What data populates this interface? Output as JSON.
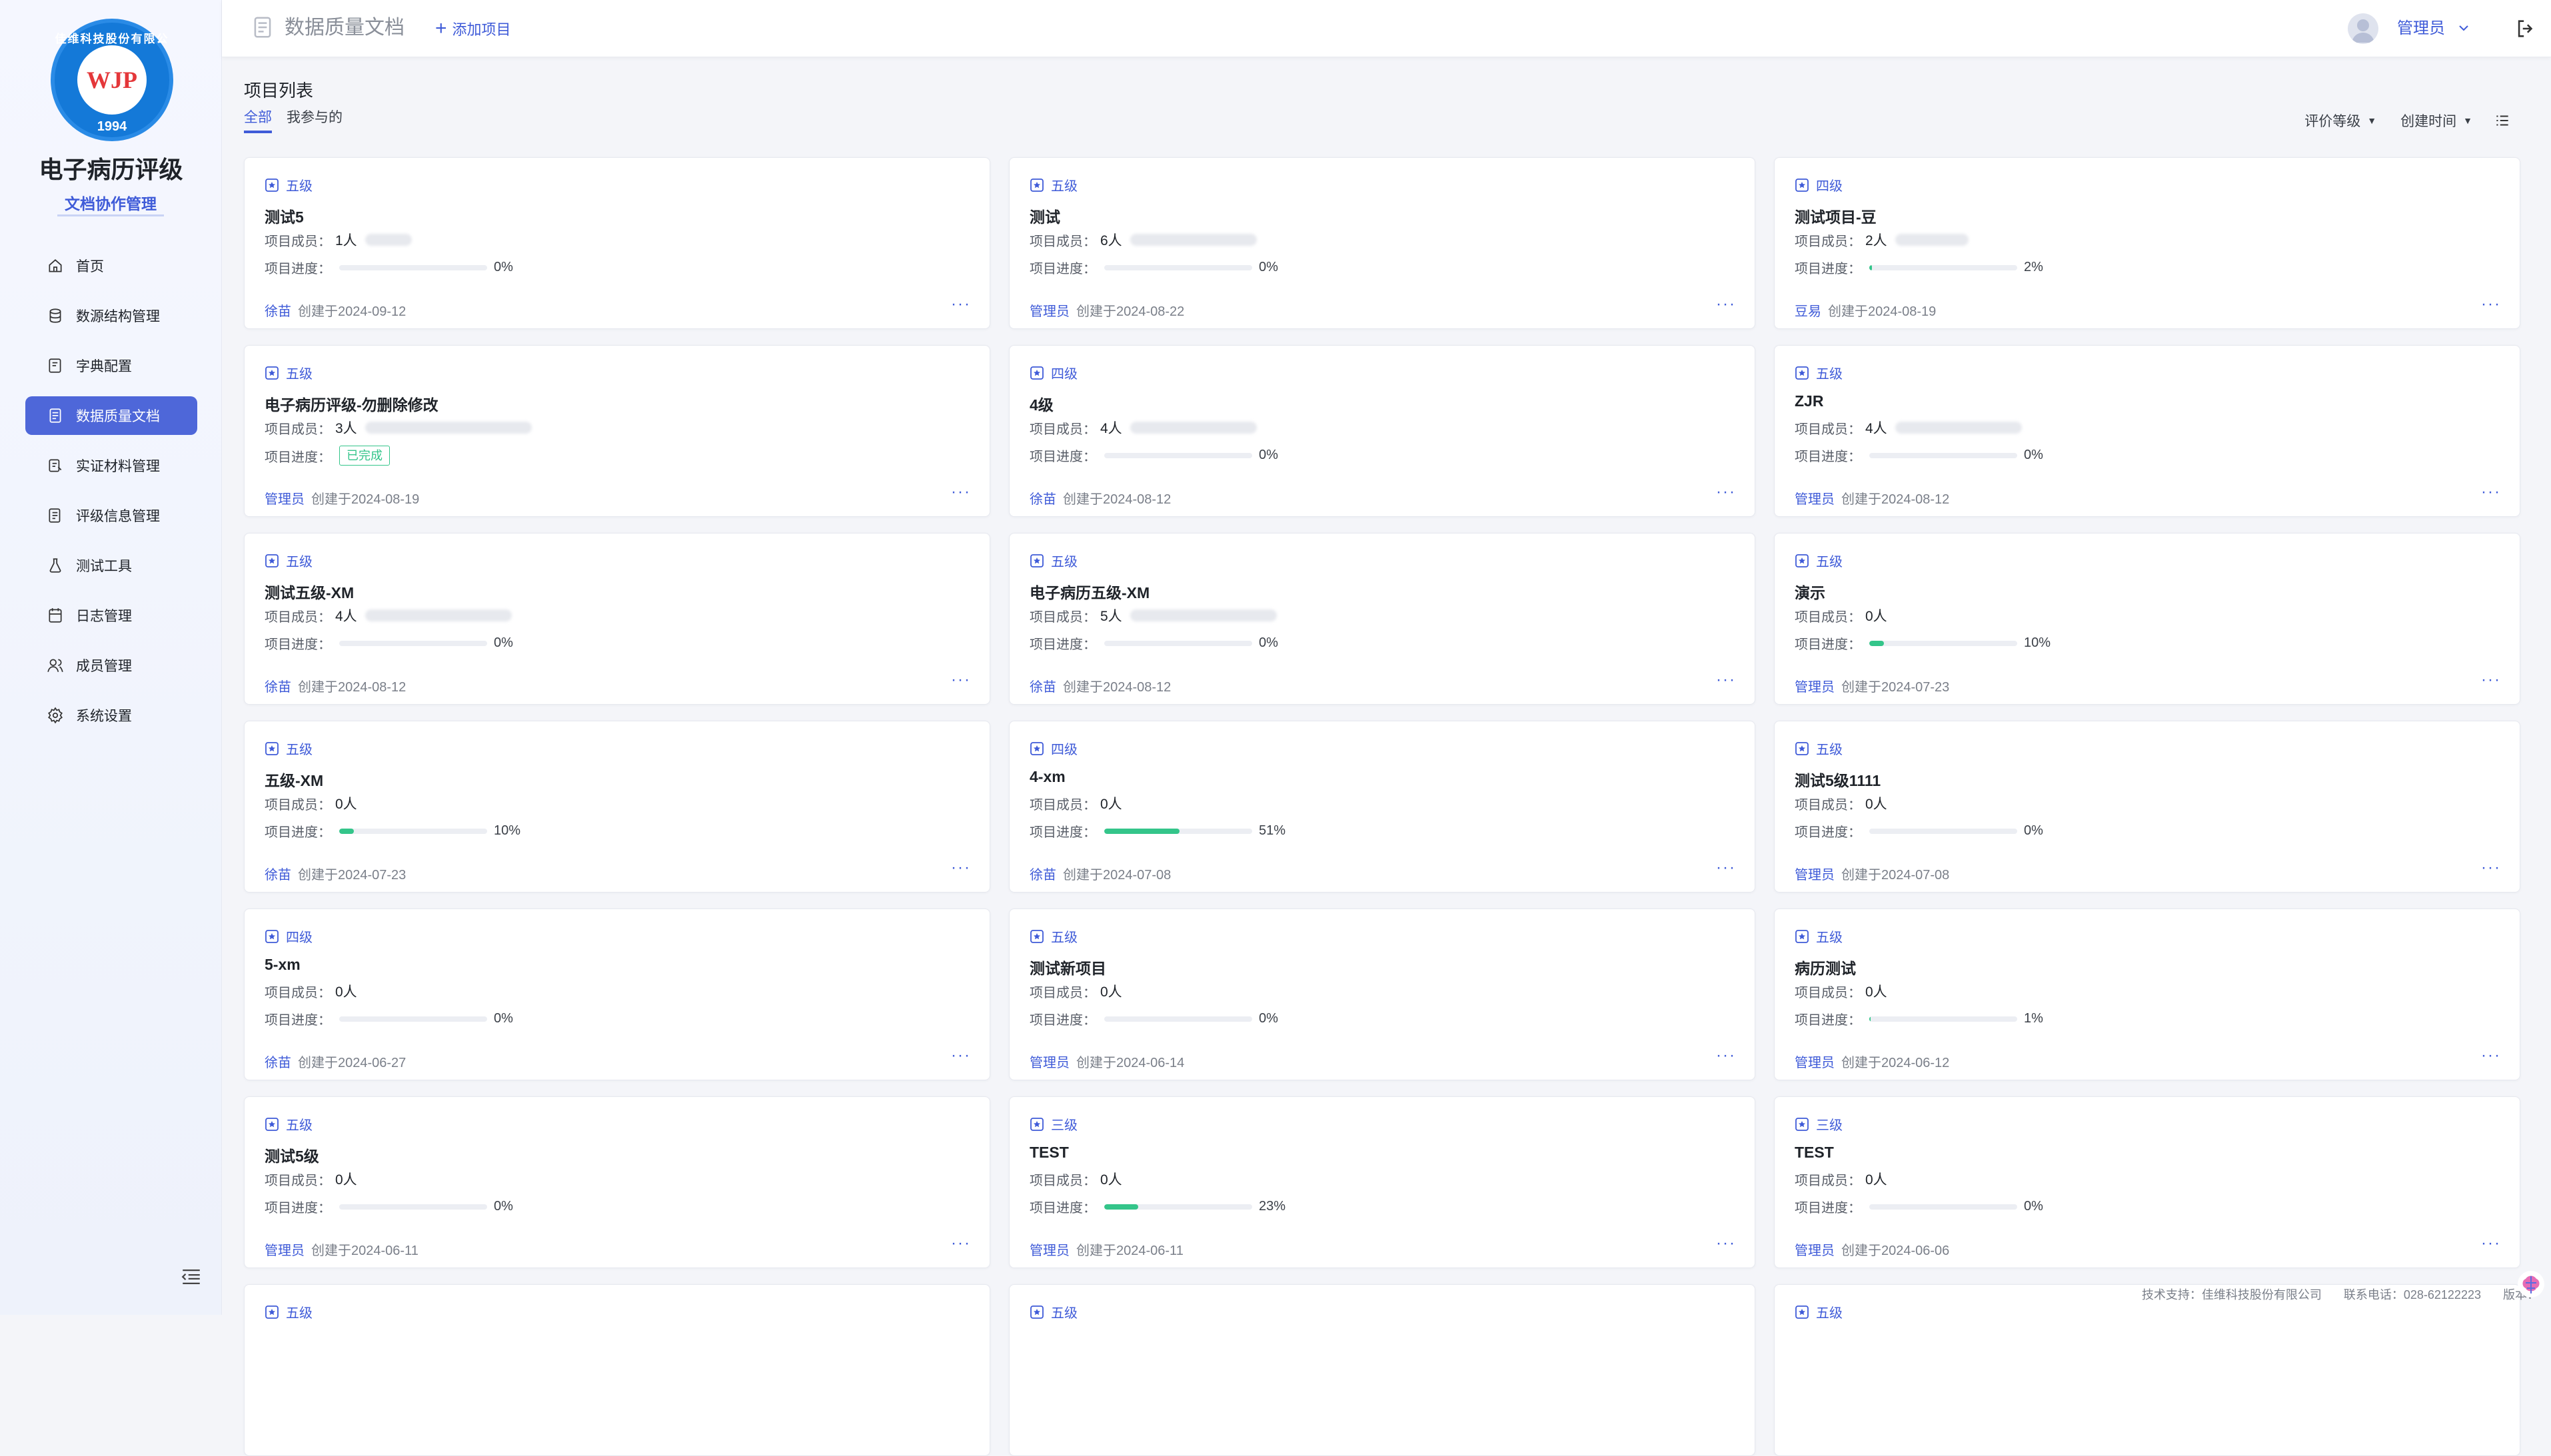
{
  "sidebar": {
    "logo": {
      "ring_text": "佳维科技股份有限公司",
      "mark": "WJP",
      "year": "1994"
    },
    "app_title": "电子病历评级",
    "app_subtitle": "文档协作管理",
    "items": [
      {
        "label": "首页",
        "icon": "home-icon"
      },
      {
        "label": "数源结构管理",
        "icon": "database-icon"
      },
      {
        "label": "字典配置",
        "icon": "dictionary-icon"
      },
      {
        "label": "数据质量文档",
        "icon": "document-icon",
        "active": true
      },
      {
        "label": "实证材料管理",
        "icon": "materials-icon"
      },
      {
        "label": "评级信息管理",
        "icon": "rating-icon"
      },
      {
        "label": "测试工具",
        "icon": "test-tool-icon"
      },
      {
        "label": "日志管理",
        "icon": "log-icon"
      },
      {
        "label": "成员管理",
        "icon": "members-icon"
      },
      {
        "label": "系统设置",
        "icon": "settings-icon"
      }
    ]
  },
  "header": {
    "title": "数据质量文档",
    "add_label": "添加项目",
    "user_name": "管理员"
  },
  "content": {
    "list_title": "项目列表",
    "tabs": [
      {
        "label": "全部",
        "active": true
      },
      {
        "label": "我参与的"
      }
    ],
    "sort": {
      "level_label": "评价等级",
      "time_label": "创建时间"
    }
  },
  "labels": {
    "members": "项目成员：",
    "progress": "项目进度：",
    "created_prefix": "创建于",
    "done": "已完成"
  },
  "projects": [
    {
      "level": "五级",
      "name": "测试5",
      "members": "1人",
      "progress": 0,
      "progress_text": "0%",
      "creator": "徐苗",
      "date": "2024-09-12"
    },
    {
      "level": "五级",
      "name": "测试",
      "members": "6人",
      "progress": 0,
      "progress_text": "0%",
      "creator": "管理员",
      "date": "2024-08-22"
    },
    {
      "level": "四级",
      "name": "测试项目-豆",
      "members": "2人",
      "progress": 2,
      "progress_text": "2%",
      "creator": "豆易",
      "date": "2024-08-19"
    },
    {
      "level": "五级",
      "name": "电子病历评级-勿删除修改",
      "members": "3人",
      "progress": 100,
      "progress_text": "已完成",
      "creator": "管理员",
      "date": "2024-08-19",
      "completed": true
    },
    {
      "level": "四级",
      "name": "4级",
      "members": "4人",
      "progress": 0,
      "progress_text": "0%",
      "creator": "徐苗",
      "date": "2024-08-12"
    },
    {
      "level": "五级",
      "name": "ZJR",
      "members": "4人",
      "progress": 0,
      "progress_text": "0%",
      "creator": "管理员",
      "date": "2024-08-12"
    },
    {
      "level": "五级",
      "name": "测试五级-XM",
      "members": "4人",
      "progress": 0,
      "progress_text": "0%",
      "creator": "徐苗",
      "date": "2024-08-12"
    },
    {
      "level": "五级",
      "name": "电子病历五级-XM",
      "members": "5人",
      "progress": 0,
      "progress_text": "0%",
      "creator": "徐苗",
      "date": "2024-08-12"
    },
    {
      "level": "五级",
      "name": "演示",
      "members": "0人",
      "progress": 10,
      "progress_text": "10%",
      "creator": "管理员",
      "date": "2024-07-23"
    },
    {
      "level": "五级",
      "name": "五级-XM",
      "members": "0人",
      "progress": 10,
      "progress_text": "10%",
      "creator": "徐苗",
      "date": "2024-07-23"
    },
    {
      "level": "四级",
      "name": "4-xm",
      "members": "0人",
      "progress": 51,
      "progress_text": "51%",
      "creator": "徐苗",
      "date": "2024-07-08"
    },
    {
      "level": "五级",
      "name": "测试5级1111",
      "members": "0人",
      "progress": 0,
      "progress_text": "0%",
      "creator": "管理员",
      "date": "2024-07-08"
    },
    {
      "level": "四级",
      "name": "5-xm",
      "members": "0人",
      "progress": 0,
      "progress_text": "0%",
      "creator": "徐苗",
      "date": "2024-06-27"
    },
    {
      "level": "五级",
      "name": "测试新项目",
      "members": "0人",
      "progress": 0,
      "progress_text": "0%",
      "creator": "管理员",
      "date": "2024-06-14"
    },
    {
      "level": "五级",
      "name": "病历测试",
      "members": "0人",
      "progress": 1,
      "progress_text": "1%",
      "creator": "管理员",
      "date": "2024-06-12"
    },
    {
      "level": "五级",
      "name": "测试5级",
      "members": "0人",
      "progress": 0,
      "progress_text": "0%",
      "creator": "管理员",
      "date": "2024-06-11"
    },
    {
      "level": "三级",
      "name": "TEST",
      "members": "0人",
      "progress": 23,
      "progress_text": "23%",
      "creator": "管理员",
      "date": "2024-06-11"
    },
    {
      "level": "三级",
      "name": "TEST",
      "members": "0人",
      "progress": 0,
      "progress_text": "0%",
      "creator": "管理员",
      "date": "2024-06-06"
    },
    {
      "level": "五级",
      "name": "",
      "members": "",
      "progress": 0,
      "progress_text": "",
      "creator": "",
      "date": ""
    },
    {
      "level": "五级",
      "name": "",
      "members": "",
      "progress": 0,
      "progress_text": "",
      "creator": "",
      "date": ""
    },
    {
      "level": "五级",
      "name": "",
      "members": "",
      "progress": 0,
      "progress_text": "",
      "creator": "",
      "date": ""
    }
  ],
  "footer": {
    "support": "技术支持：佳维科技股份有限公司",
    "phone": "联系电话：028-62122223",
    "version": "版本："
  },
  "colors": {
    "primary": "#3f5bd8",
    "active_menu": "#4e67d9",
    "progress": "#34c58a"
  }
}
